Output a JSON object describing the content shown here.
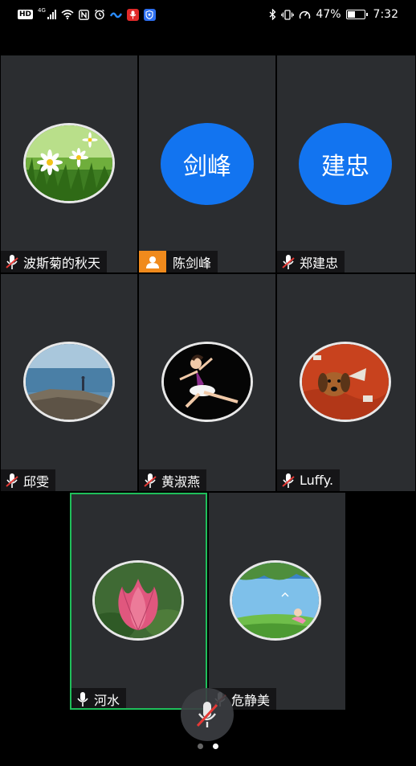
{
  "status_bar": {
    "network_type": "HD",
    "signal_gen": "4G",
    "battery_percent": "47%",
    "time": "7:32",
    "battery_level": 0.47
  },
  "participants": [
    {
      "name": "波斯菊的秋天",
      "avatar": "daisy-photo",
      "mic": "muted"
    },
    {
      "name": "陈剑峰",
      "avatar_text": "剑峰",
      "role": "host"
    },
    {
      "name": "郑建忠",
      "avatar_text": "建忠",
      "mic": "muted"
    },
    {
      "name": "邱雯",
      "avatar": "seaside-photo",
      "mic": "muted"
    },
    {
      "name": "黄淑燕",
      "avatar": "dancer-photo",
      "mic": "muted"
    },
    {
      "name": "Luffy.",
      "avatar": "dog-photo",
      "mic": "muted"
    },
    {
      "name": "河水",
      "avatar": "lotus-photo",
      "mic": "on",
      "active": true
    },
    {
      "name": "危静美",
      "avatar": "landscape-photo",
      "mic": "muted"
    }
  ],
  "controls": {
    "self_mic": "muted"
  },
  "pagination": {
    "pages": 2,
    "current": 2
  },
  "colors": {
    "tile_bg": "#2b2d30",
    "avatar_blue": "#1274f0",
    "host_orange": "#f08a1c",
    "active_border": "#1fbf5a",
    "muted_red": "#e53935"
  }
}
